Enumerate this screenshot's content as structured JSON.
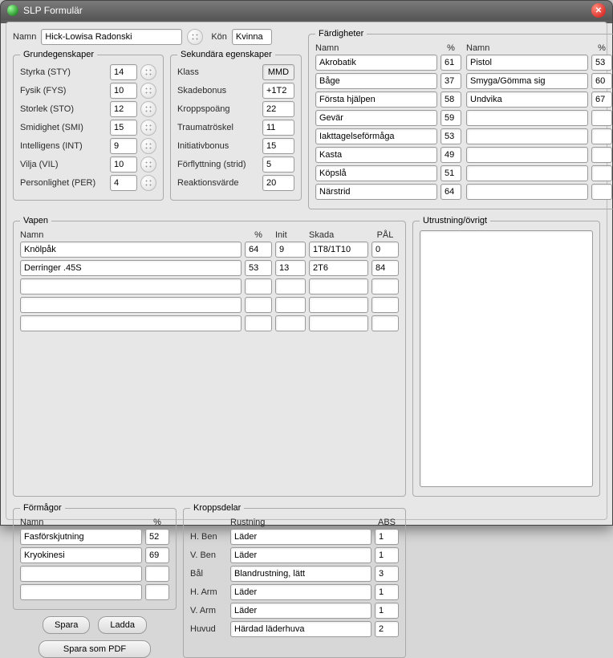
{
  "window": {
    "title": "SLP Formulär"
  },
  "top": {
    "name_label": "Namn",
    "name_value": "Hick-Lowisa Radonski",
    "gender_label": "Kön",
    "gender_value": "Kvinna"
  },
  "basic": {
    "legend": "Grundegenskaper",
    "rows": [
      {
        "label": "Styrka (STY)",
        "value": "14"
      },
      {
        "label": "Fysik (FYS)",
        "value": "10"
      },
      {
        "label": "Storlek (STO)",
        "value": "12"
      },
      {
        "label": "Smidighet (SMI)",
        "value": "15"
      },
      {
        "label": "Intelligens (INT)",
        "value": "9"
      },
      {
        "label": "Vilja (VIL)",
        "value": "10"
      },
      {
        "label": "Personlighet (PER)",
        "value": "4"
      }
    ]
  },
  "secondary": {
    "legend": "Sekundära egenskaper",
    "rows": [
      {
        "label": "Klass",
        "value": "MMD",
        "readonly": true
      },
      {
        "label": "Skadebonus",
        "value": "+1T2"
      },
      {
        "label": "Kroppspoäng",
        "value": "22"
      },
      {
        "label": "Traumatröskel",
        "value": "11"
      },
      {
        "label": "Initiativbonus",
        "value": "15"
      },
      {
        "label": "Förflyttning (strid)",
        "value": "5"
      },
      {
        "label": "Reaktionsvärde",
        "value": "20"
      }
    ]
  },
  "skills": {
    "legend": "Färdigheter",
    "name_hdr": "Namn",
    "pct_hdr": "%",
    "name_hdr2": "Namn",
    "pct_hdr2": "%",
    "left": [
      {
        "name": "Akrobatik",
        "pct": "61"
      },
      {
        "name": "Båge",
        "pct": "37"
      },
      {
        "name": "Första hjälpen",
        "pct": "58"
      },
      {
        "name": "Gevär",
        "pct": "59"
      },
      {
        "name": "Iakttagelseförmåga",
        "pct": "53"
      },
      {
        "name": "Kasta",
        "pct": "49"
      },
      {
        "name": "Köpslå",
        "pct": "51"
      },
      {
        "name": "Närstrid",
        "pct": "64"
      }
    ],
    "right": [
      {
        "name": "Pistol",
        "pct": "53"
      },
      {
        "name": "Smyga/Gömma sig",
        "pct": "60"
      },
      {
        "name": "Undvika",
        "pct": "67"
      },
      {
        "name": "",
        "pct": ""
      },
      {
        "name": "",
        "pct": ""
      },
      {
        "name": "",
        "pct": ""
      },
      {
        "name": "",
        "pct": ""
      },
      {
        "name": "",
        "pct": ""
      }
    ]
  },
  "weapons": {
    "legend": "Vapen",
    "hdr": {
      "name": "Namn",
      "pct": "%",
      "init": "Init",
      "dmg": "Skada",
      "pal": "PÅL"
    },
    "rows": [
      {
        "name": "Knölpåk",
        "pct": "64",
        "init": "9",
        "dmg": "1T8/1T10",
        "pal": "0"
      },
      {
        "name": "Derringer .45S",
        "pct": "53",
        "init": "13",
        "dmg": "2T6",
        "pal": "84"
      },
      {
        "name": "",
        "pct": "",
        "init": "",
        "dmg": "",
        "pal": ""
      },
      {
        "name": "",
        "pct": "",
        "init": "",
        "dmg": "",
        "pal": ""
      },
      {
        "name": "",
        "pct": "",
        "init": "",
        "dmg": "",
        "pal": ""
      }
    ]
  },
  "abilities": {
    "legend": "Förmågor",
    "hdr": {
      "name": "Namn",
      "pct": "%"
    },
    "rows": [
      {
        "name": "Fasförskjutning",
        "pct": "52"
      },
      {
        "name": "Kryokinesi",
        "pct": "69"
      },
      {
        "name": "",
        "pct": ""
      },
      {
        "name": "",
        "pct": ""
      }
    ]
  },
  "bodyparts": {
    "legend": "Kroppsdelar",
    "hdr": {
      "armor": "Rustning",
      "abs": "ABS"
    },
    "rows": [
      {
        "part": "H. Ben",
        "armor": "Läder",
        "abs": "1"
      },
      {
        "part": "V. Ben",
        "armor": "Läder",
        "abs": "1"
      },
      {
        "part": "Bål",
        "armor": "Blandrustning, lätt",
        "abs": "3"
      },
      {
        "part": "H. Arm",
        "armor": "Läder",
        "abs": "1"
      },
      {
        "part": "V. Arm",
        "armor": "Läder",
        "abs": "1"
      },
      {
        "part": "Huvud",
        "armor": "Härdad läderhuva",
        "abs": "2"
      }
    ]
  },
  "equip": {
    "legend": "Utrustning/övrigt",
    "value": ""
  },
  "buttons": {
    "save": "Spara",
    "load": "Ladda",
    "pdf": "Spara som PDF"
  }
}
